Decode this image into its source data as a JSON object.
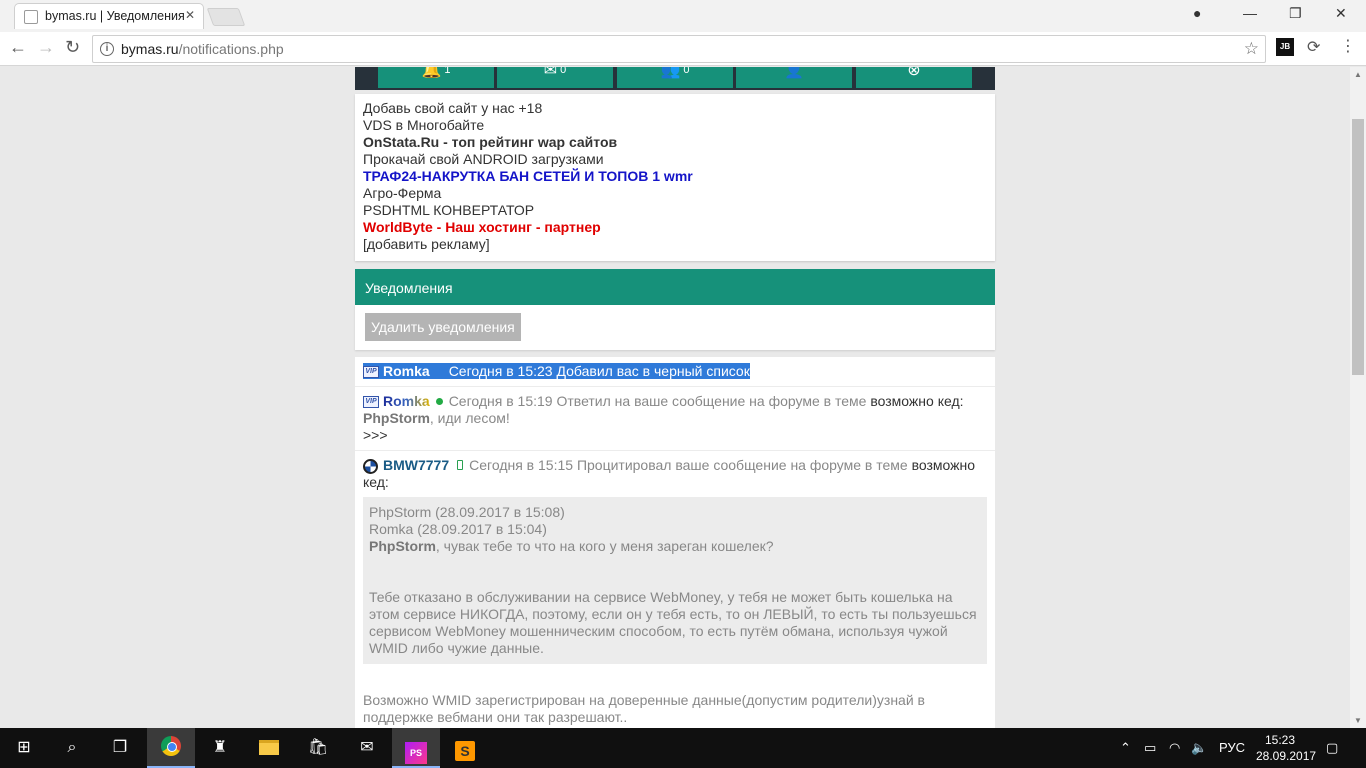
{
  "browser": {
    "tab_title": "bymas.ru | Уведомления",
    "url_host": "bymas.ru",
    "url_path": "/notifications.php",
    "ext_jb": "JB"
  },
  "topnav": {
    "items": [
      {
        "icon": "bell-icon",
        "glyph": "🔔",
        "count": "1"
      },
      {
        "icon": "envelope-icon",
        "glyph": "✉",
        "count": "0"
      },
      {
        "icon": "users-icon",
        "glyph": "👥",
        "count": "0"
      },
      {
        "icon": "user-icon",
        "glyph": "👤",
        "count": ""
      },
      {
        "icon": "logout-icon",
        "glyph": "⊗",
        "count": ""
      }
    ]
  },
  "ads": [
    {
      "text": "Добавь свой сайт у нас +18",
      "style": "normal"
    },
    {
      "text": "VDS в Многобайте",
      "style": "normal"
    },
    {
      "text": "OnStata.Ru - топ рейтинг wap сайтов",
      "style": "bold"
    },
    {
      "text": "Прокачай свой ANDROID загрузками",
      "style": "normal"
    },
    {
      "text": "ТРАФ24-НАКРУТКА БАН СЕТЕЙ И ТОПОВ 1 wmr",
      "style": "blue"
    },
    {
      "text": "Агро-Ферма",
      "style": "normal"
    },
    {
      "text": "PSDHTML КОНВЕРТАТОР",
      "style": "normal"
    },
    {
      "text": "WorldByte - Наш хостинг - партнер",
      "style": "red"
    },
    {
      "text": "[добавить рекламу]",
      "style": "normal"
    }
  ],
  "notifications_section": {
    "title": "Уведомления",
    "delete_label": "Удалить уведомления"
  },
  "notifications": [
    {
      "user": "Romka",
      "status_color": "#2f7ad9",
      "time": "Сегодня в 15:23",
      "text": "Добавил вас в черный список"
    },
    {
      "user": "Romka",
      "status_color": "#22aa44",
      "time": "Сегодня в 15:19",
      "text": "Ответил на ваше сообщение на форуме в теме",
      "topic": "возможно кед:",
      "reply_author": "PhpStorm",
      "reply_text": ", иди лесом!",
      "more": ">>>"
    },
    {
      "user": "BMW7777",
      "time": "Сегодня в 15:15",
      "text": "Процитировал ваше сообщение на форуме в теме",
      "topic": "возможно кед:",
      "quote_header_1": "PhpStorm (28.09.2017 в 15:08)",
      "quote_header_2": "Romka (28.09.2017 в 15:04)",
      "quote_author": "PhpStorm",
      "quote_line": ", чувак тебе то что на кого у меня зареган кошелек?",
      "quote_body": "Тебе отказано в обслуживании на сервисе WebMoney, у тебя не может быть кошелька на этом сервисе НИКОГДА, поэтому, если он у тебя есть, то он ЛЕВЫЙ, то есть ты пользуешься сервисом WebMoney мошенническим способом, то есть путём обмана, используя чужой WMID либо чужие данные.",
      "after_quote": "Возможно WMID зарегистрирован на доверенные данные(допустим родители)узнай в поддержке вебмани они так разрешают.."
    }
  ],
  "taskbar": {
    "language": "РУС",
    "time": "15:23",
    "date": "28.09.2017",
    "ps_label": "PS",
    "sublime_label": "S"
  }
}
